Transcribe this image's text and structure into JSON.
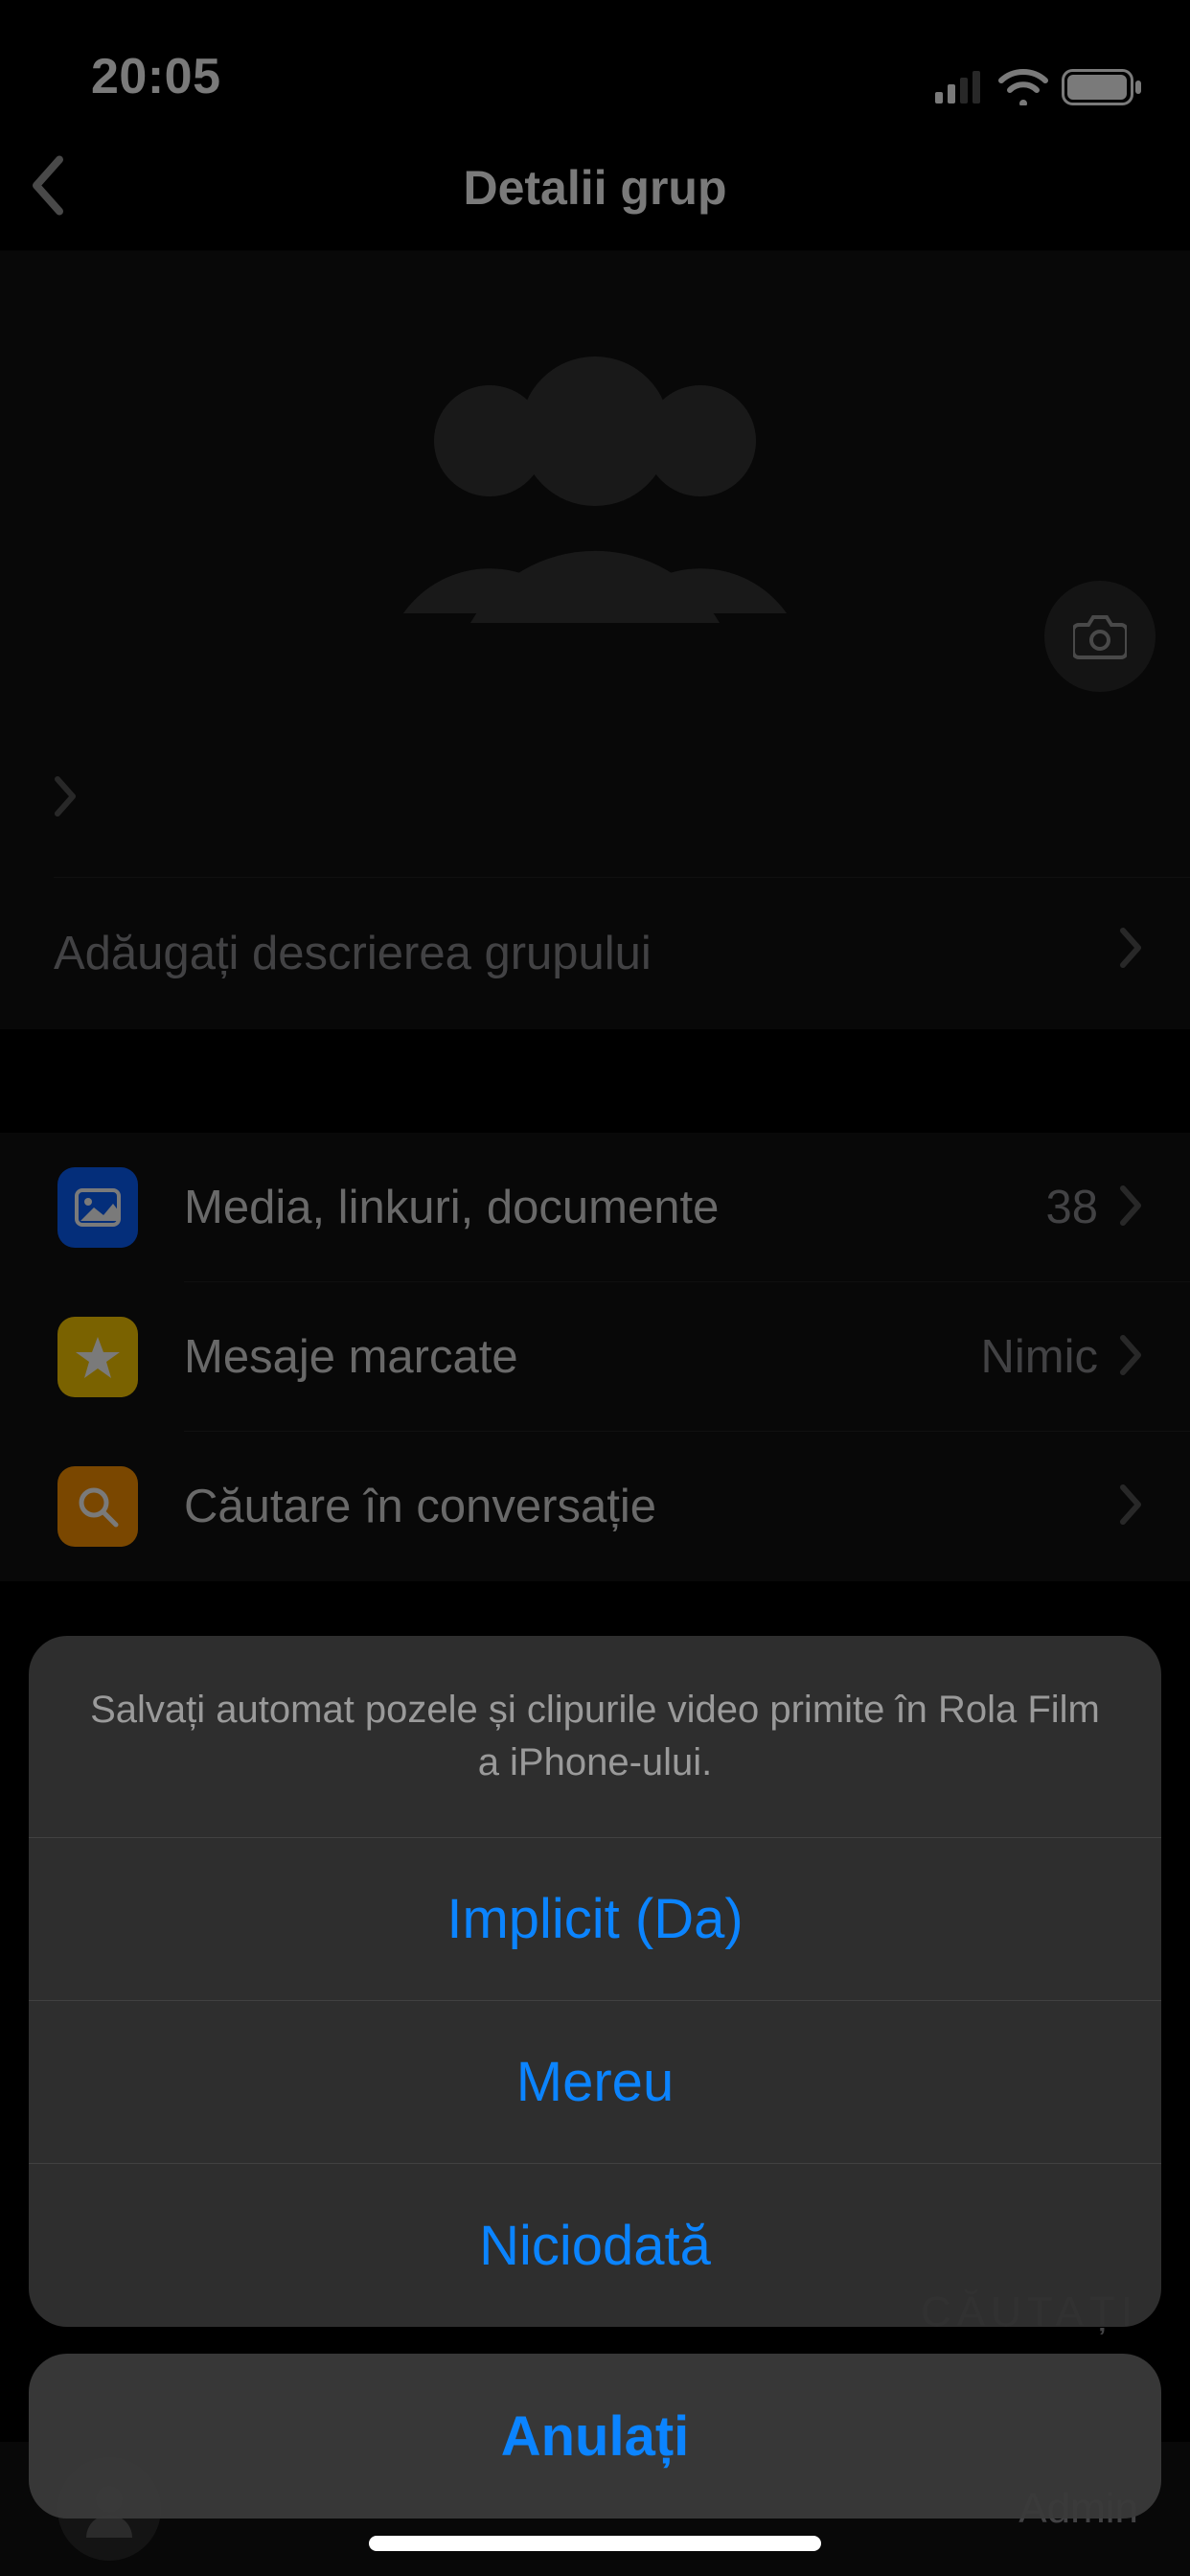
{
  "status_bar": {
    "time": "20:05"
  },
  "nav": {
    "title": "Detalii grup"
  },
  "group_name_row": {
    "label": ""
  },
  "description_row": {
    "label": "Adăugați descrierea grupului"
  },
  "rows": {
    "media": {
      "label": "Media, linkuri, documente",
      "value": "38"
    },
    "starred": {
      "label": "Mesaje marcate",
      "value": "Nimic"
    },
    "search": {
      "label": "Căutare în conversație"
    }
  },
  "bg_hints": {
    "line1": "CĂUTAȚI",
    "line2": "Admin"
  },
  "action_sheet": {
    "prompt": "Salvați automat pozele și clipurile video primite în Rola Film a iPhone-ului.",
    "options": {
      "default": "Implicit (Da)",
      "always": "Mereu",
      "never": "Niciodată"
    },
    "cancel": "Anulați"
  },
  "icons": {
    "back": "back-icon",
    "group": "group-icon",
    "camera": "camera-icon",
    "chevron": "chevron-right-icon",
    "picture": "picture-icon",
    "star": "star-icon",
    "magnifier": "search-icon",
    "person": "person-icon"
  },
  "colors": {
    "accent": "#0b84ff",
    "bg_cell": "#111111",
    "secondary_text": "#8a8a8e"
  }
}
